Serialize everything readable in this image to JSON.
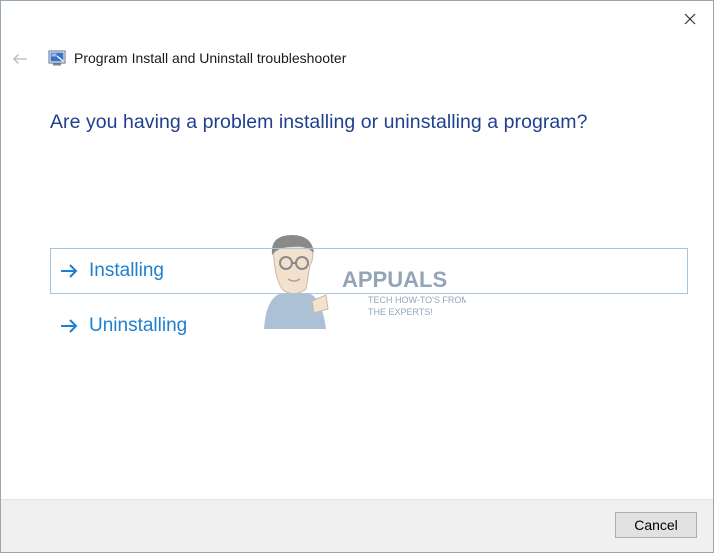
{
  "window": {
    "title": "Program Install and Uninstall troubleshooter"
  },
  "icons": {
    "close": "close-icon",
    "back": "back-arrow-icon",
    "app": "troubleshooter-app-icon",
    "option_arrow": "right-arrow-icon"
  },
  "main": {
    "question": "Are you having a problem installing or uninstalling a program?",
    "options": [
      {
        "label": "Installing",
        "highlighted": true
      },
      {
        "label": "Uninstalling",
        "highlighted": false
      }
    ]
  },
  "watermark": {
    "brand": "APPUALS",
    "tagline_1": "TECH HOW-TO'S FROM",
    "tagline_2": "THE EXPERTS!"
  },
  "footer": {
    "cancel_label": "Cancel"
  },
  "colors": {
    "question": "#1f3f8f",
    "option_text": "#1e7fcf",
    "option_border": "#a7c6de",
    "footer_bg": "#f0f0f0"
  }
}
